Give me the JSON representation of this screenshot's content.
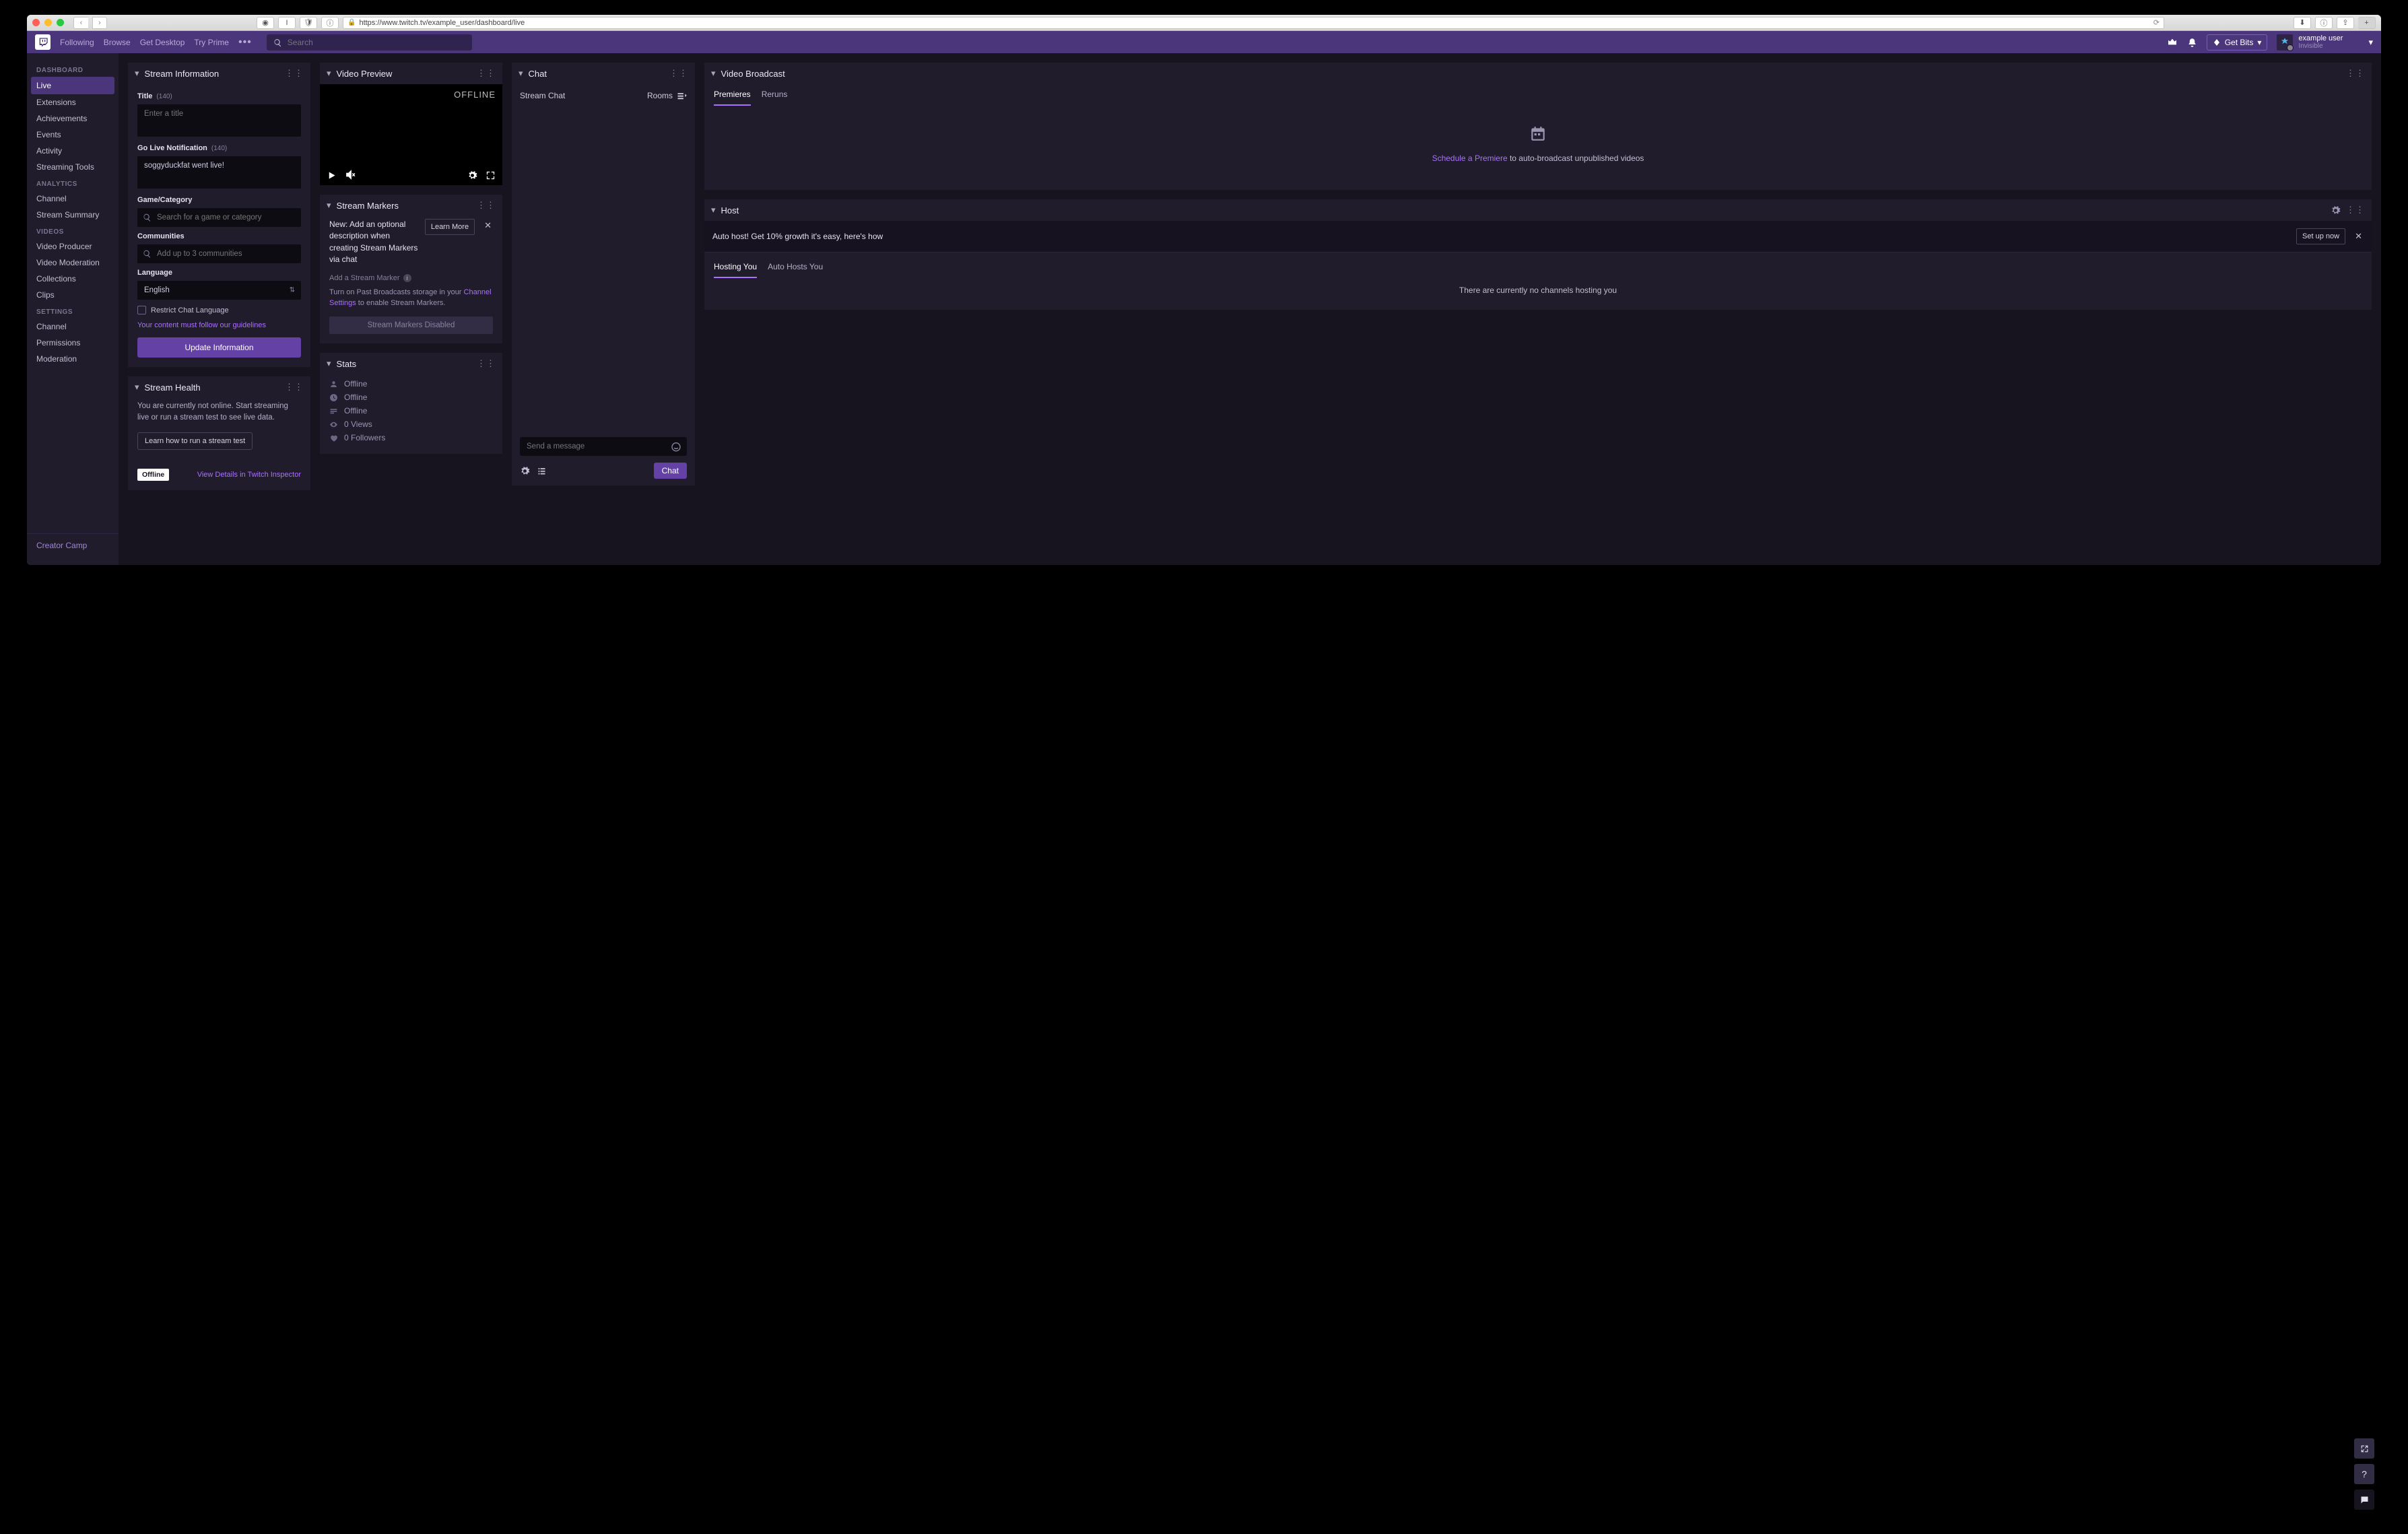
{
  "browser": {
    "url": "https://www.twitch.tv/example_user/dashboard/live"
  },
  "topnav": {
    "links": [
      "Following",
      "Browse",
      "Get Desktop",
      "Try Prime"
    ],
    "search_placeholder": "Search",
    "get_bits_label": "Get Bits",
    "user_name": "example user",
    "user_status": "Invisible"
  },
  "sidebar": {
    "groups": [
      {
        "header": "DASHBOARD",
        "items": [
          "Live",
          "Extensions",
          "Achievements",
          "Events",
          "Activity",
          "Streaming Tools"
        ],
        "active_index": 0
      },
      {
        "header": "ANALYTICS",
        "items": [
          "Channel",
          "Stream Summary"
        ]
      },
      {
        "header": "VIDEOS",
        "items": [
          "Video Producer",
          "Video Moderation",
          "Collections",
          "Clips"
        ]
      },
      {
        "header": "SETTINGS",
        "items": [
          "Channel",
          "Permissions",
          "Moderation"
        ]
      }
    ],
    "footer_link": "Creator Camp"
  },
  "stream_info": {
    "panel_title": "Stream Information",
    "title_label": "Title",
    "title_limit": "(140)",
    "title_placeholder": "Enter a title",
    "golive_label": "Go Live Notification",
    "golive_limit": "(140)",
    "golive_value": "soggyduckfat went live!",
    "game_label": "Game/Category",
    "game_placeholder": "Search for a game or category",
    "communities_label": "Communities",
    "communities_placeholder": "Add up to 3 communities",
    "language_label": "Language",
    "language_value": "English",
    "restrict_label": "Restrict Chat Language",
    "guidelines_text": "Your content must follow our guidelines",
    "update_btn": "Update Information"
  },
  "stream_health": {
    "panel_title": "Stream Health",
    "message": "You are currently not online. Start streaming live or run a stream test to see live data.",
    "learn_btn": "Learn how to run a stream test",
    "status_badge": "Offline",
    "view_details": "View Details in Twitch Inspector"
  },
  "video_preview": {
    "panel_title": "Video Preview",
    "status": "OFFLINE"
  },
  "stream_markers": {
    "panel_title": "Stream Markers",
    "notice": "New: Add an optional description when creating Stream Markers via chat",
    "learn_more": "Learn More",
    "add_label": "Add a Stream Marker",
    "hint_pre": "Turn on Past Broadcasts storage in your ",
    "hint_link": "Channel Settings",
    "hint_post": " to enable Stream Markers.",
    "disabled_btn": "Stream Markers Disabled"
  },
  "stats": {
    "panel_title": "Stats",
    "rows": [
      "Offline",
      "Offline",
      "Offline",
      "0 Views",
      "0 Followers"
    ]
  },
  "chat": {
    "panel_title": "Chat",
    "tab": "Stream Chat",
    "rooms_label": "Rooms",
    "input_placeholder": "Send a message",
    "chat_btn": "Chat"
  },
  "video_broadcast": {
    "panel_title": "Video Broadcast",
    "tabs": [
      "Premieres",
      "Reruns"
    ],
    "active_tab": 0,
    "hint_link": "Schedule a Premiere",
    "hint_text": " to auto-broadcast unpublished videos"
  },
  "host": {
    "panel_title": "Host",
    "banner_msg": "Auto host! Get 10% growth it's easy, here's how",
    "setup_btn": "Set up now",
    "tabs": [
      "Hosting You",
      "Auto Hosts You"
    ],
    "active_tab": 0,
    "empty": "There are currently no channels hosting you"
  }
}
